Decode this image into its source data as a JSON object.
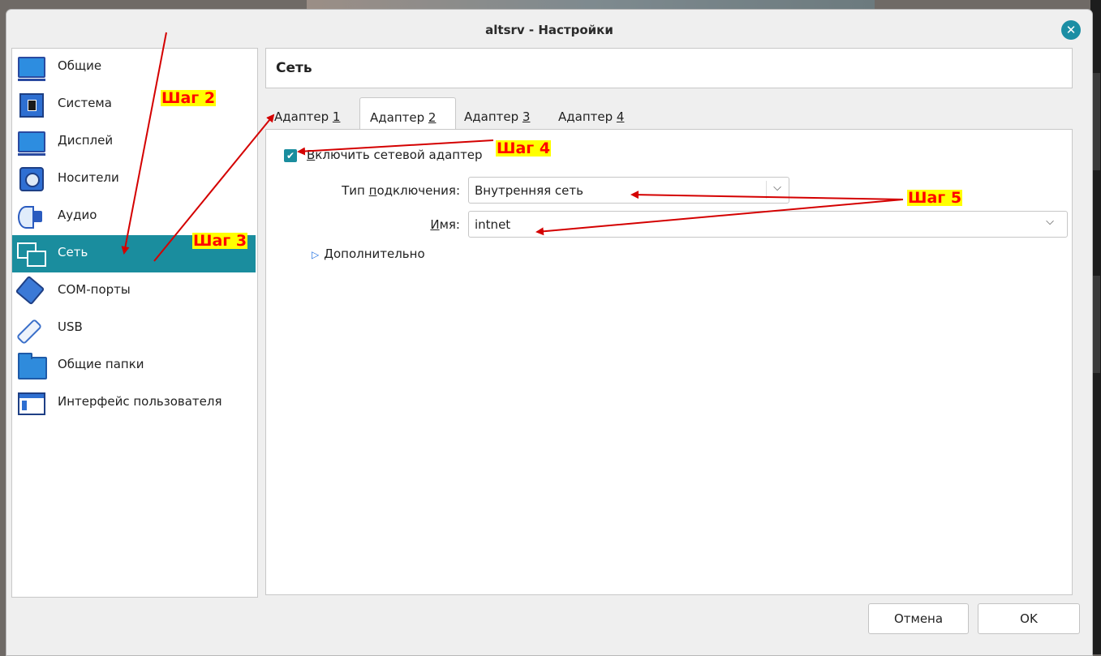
{
  "window": {
    "title": "altsrv - Настройки",
    "close_icon": "close-icon"
  },
  "sidebar": {
    "items": [
      {
        "label": "Общие",
        "icon": "general-monitor-icon"
      },
      {
        "label": "Система",
        "icon": "system-chip-icon"
      },
      {
        "label": "Дисплей",
        "icon": "display-monitor-icon"
      },
      {
        "label": "Носители",
        "icon": "storage-disk-icon"
      },
      {
        "label": "Аудио",
        "icon": "audio-speaker-icon"
      },
      {
        "label": "Сеть",
        "icon": "network-icon",
        "selected": true
      },
      {
        "label": "COM-порты",
        "icon": "serial-port-icon"
      },
      {
        "label": "USB",
        "icon": "usb-icon"
      },
      {
        "label": "Общие папки",
        "icon": "shared-folder-icon"
      },
      {
        "label": "Интерфейс пользователя",
        "icon": "user-interface-icon"
      }
    ]
  },
  "section": {
    "title": "Сеть"
  },
  "tabs": [
    {
      "prefix": "Адаптер ",
      "key": "1"
    },
    {
      "prefix": "Адаптер ",
      "key": "2",
      "active": true
    },
    {
      "prefix": "Адаптер ",
      "key": "3"
    },
    {
      "prefix": "Адаптер ",
      "key": "4"
    }
  ],
  "adapter": {
    "enable_label_key": "В",
    "enable_label_rest": "ключить сетевой адаптер",
    "enable_checked": true,
    "attached_label_pre": "Тип ",
    "attached_label_key": "п",
    "attached_label_post": "одключения:",
    "attached_value": "Внутренняя сеть",
    "name_label_key": "И",
    "name_label_post": "мя:",
    "name_value": "intnet",
    "advanced_key": "Д",
    "advanced_rest": "ополнительно"
  },
  "buttons": {
    "cancel": "Отмена",
    "ok": "OK"
  },
  "annotations": {
    "step2": "Шаг 2",
    "step3": "Шаг 3",
    "step4": "Шаг 4",
    "step5": "Шаг 5",
    "color": "#e00000",
    "highlight": "#ffff00"
  },
  "colors": {
    "accent": "#1a8d9e",
    "window_bg": "#efefef"
  }
}
